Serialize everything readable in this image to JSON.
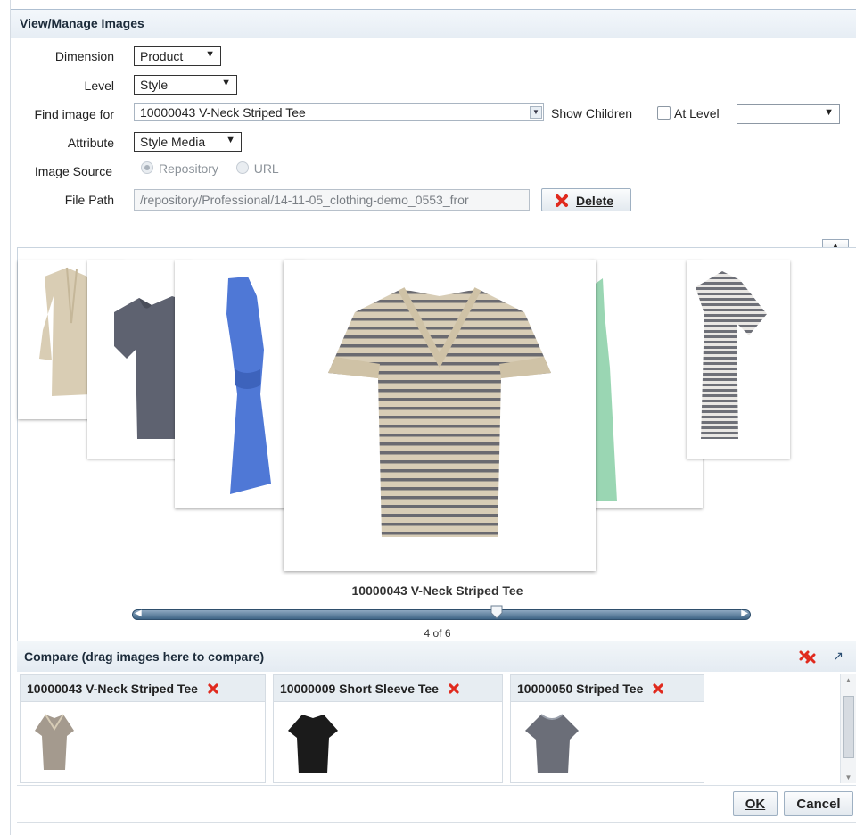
{
  "dialog": {
    "title": "View/Manage Images"
  },
  "form": {
    "dimension_label": "Dimension",
    "dimension_value": "Product",
    "level_label": "Level",
    "level_value": "Style",
    "find_label": "Find image for",
    "find_value": "10000043 V-Neck Striped Tee",
    "show_children_label": "Show Children",
    "at_level_label": "At Level",
    "at_level_value": "",
    "attribute_label": "Attribute",
    "attribute_value": "Style Media",
    "image_source_label": "Image Source",
    "image_source_options": [
      "Repository",
      "URL"
    ],
    "image_source_selected": "Repository",
    "file_path_label": "File Path",
    "file_path_value": "/repository/Professional/14-11-05_clothing-demo_0553_fror",
    "delete_label": "Delete"
  },
  "viewer": {
    "caption": "10000043 V-Neck Striped Tee",
    "position": 4,
    "total": 6,
    "counter_text": "4 of 6"
  },
  "compare": {
    "title": "Compare (drag images here to compare)",
    "items": [
      {
        "label": "10000043 V-Neck Striped Tee",
        "color": "#a49a8e"
      },
      {
        "label": "10000009 Short Sleeve Tee",
        "color": "#1b1b1b"
      },
      {
        "label": "10000050 Striped Tee",
        "color": "#6b6e78"
      }
    ]
  },
  "footer": {
    "ok_label": "OK",
    "cancel_label": "Cancel"
  },
  "colors": {
    "accent": "#3f6586",
    "delete_red": "#e02a1e"
  }
}
